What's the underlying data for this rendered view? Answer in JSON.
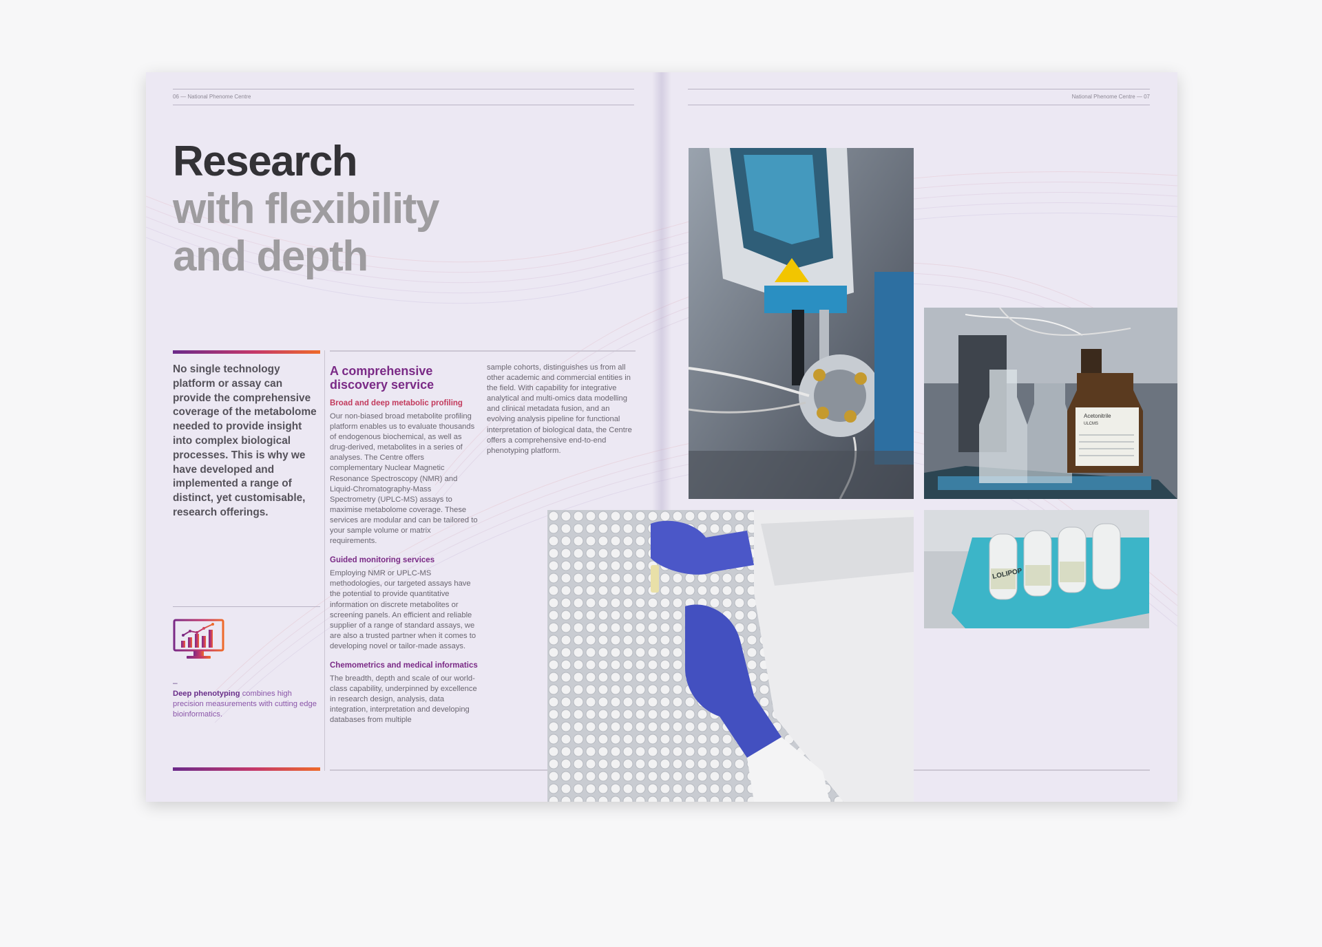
{
  "running_heads": {
    "left": "06 — National Phenome Centre",
    "right": "National Phenome Centre — 07"
  },
  "title": {
    "line1": "Research",
    "line2": "with flexibility",
    "line3": "and depth"
  },
  "intro": "No single technology platform or assay can provide the comprehensive coverage of the metabolome needed to provide insight into complex biological processes. This is why we have developed and implemented a range of distinct, yet customisable, research offerings.",
  "sidebar": {
    "icon": "monitor-chart-icon",
    "dash": "–",
    "caption_bold": "Deep phenotyping",
    "caption_rest": " combines high precision measurements with cutting edge bioinformatics."
  },
  "section": {
    "title": "A comprehensive discovery service",
    "blocks": [
      {
        "heading": "Broad and deep metabolic profiling",
        "body": "Our non-biased broad metabolite profiling platform enables us to evaluate thousands of endogenous biochemical, as well as drug-derived, metabolites in a series of analyses. The Centre offers complementary Nuclear Magnetic Resonance Spectroscopy (NMR) and Liquid-Chromatography-Mass Spectrometry (UPLC-MS) assays to maximise metabolome coverage. These services are modular and can be tailored to your sample volume or matrix requirements."
      },
      {
        "heading": "Guided monitoring services",
        "body": "Employing NMR or UPLC-MS methodologies, our targeted assays have the potential to provide quantitative information on discrete metabolites or screening panels. An efficient and reliable supplier of a range of standard assays, we are also a trusted partner when it comes to developing novel or tailor-made assays."
      },
      {
        "heading": "Chemometrics and medical informatics",
        "body": "The breadth, depth and scale of our world-class capability, underpinned by excellence in research design, analysis, data integration, interpretation and developing databases from multiple"
      }
    ],
    "continuation": "sample cohorts, distinguishes us from all other academic and commercial entities in the field. With capability for integrative analytical and multi-omics data modelling and clinical metadata fusion, and an evolving analysis pipeline for functional interpretation of biological data, the Centre offers a comprehensive end-to-end phenotyping platform."
  },
  "photos": {
    "instrument_label": "mass-spectrometer-probe-photo",
    "bottles_label": "solvent-bottles-photo",
    "bottles_text_1": "Acetonitrile",
    "bottles_text_2": "ULCMS",
    "vials_label": "gloved-hands-sample-vials-photo",
    "tubes_label": "labelled-tubes-rack-photo",
    "tubes_text": "LOLIPOP"
  },
  "colors": {
    "page": "#ece8f3",
    "title_dark": "#333236",
    "title_grey": "#9e9c9f",
    "accent_purple": "#7a2a86",
    "accent_red": "#c23a5c",
    "accent_orange": "#ee6a2a"
  }
}
